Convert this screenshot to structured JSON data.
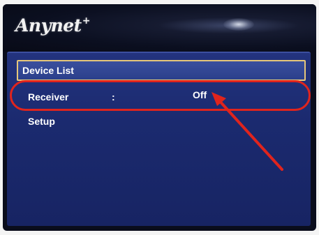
{
  "header": {
    "logo_text": "Anynet",
    "logo_suffix": "+"
  },
  "menu": {
    "items": [
      {
        "label": "Device List",
        "selected": true
      },
      {
        "label": "Receiver",
        "separator": ":",
        "value": "Off"
      },
      {
        "label": "Setup"
      }
    ]
  },
  "annotation": {
    "ellipse_color": "#e0241d",
    "arrow_color": "#e0241d"
  },
  "colors": {
    "panel": "#1b2a6f",
    "selection_border": "#e6c77a",
    "text": "#ffffff"
  }
}
